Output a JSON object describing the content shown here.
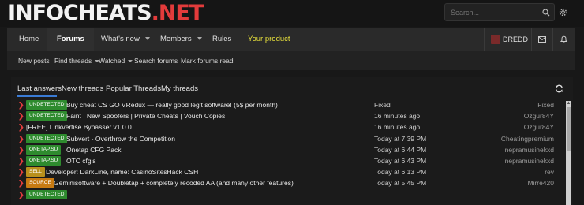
{
  "header": {
    "logo_part1": "INFOCHEATS",
    "logo_part2": ".NET",
    "search_placeholder": "Search...",
    "search_icon": "search-icon",
    "settings_icon": "gear-icon"
  },
  "nav": {
    "items": [
      {
        "label": "Home"
      },
      {
        "label": "Forums"
      },
      {
        "label": "What's new"
      },
      {
        "label": "Members"
      },
      {
        "label": "Rules"
      },
      {
        "label": "Your product"
      }
    ],
    "username": "DREDD",
    "mail_icon": "envelope-icon",
    "alert_icon": "bell-icon"
  },
  "subnav": {
    "items": [
      {
        "label": "New posts"
      },
      {
        "label": "Find threads"
      },
      {
        "label": "Watched"
      },
      {
        "label": "Search forums"
      },
      {
        "label": "Mark forums read"
      }
    ]
  },
  "tabs": [
    {
      "label": "Last answers"
    },
    {
      "label": "New threads"
    },
    {
      "label": "Popular Threads"
    },
    {
      "label": "My threads"
    }
  ],
  "colors": {
    "accent_red": "#e23c3c",
    "tab_underline": "#3a7bd5",
    "your_product": "#e8e13c",
    "badge_undetected": "#2e8b2e",
    "badge_onetap": "#2e8b2e",
    "badge_sell": "#b9901c",
    "badge_source": "#c77a12"
  },
  "threads": [
    {
      "prefix": "UNDETECTED",
      "prefix_color": "#2e8b2e",
      "title": "Buy cheat CS GO VRedux — really good legit software! (5$ per month)",
      "date": "Fixed",
      "user": "Fixed"
    },
    {
      "prefix": "UNDETECTED",
      "prefix_color": "#2e8b2e",
      "title": "Faint | New Spoofers | Private Cheats | Vouch Copies",
      "date": "16 minutes ago",
      "user": "Ozgur84Y"
    },
    {
      "prefix": "",
      "prefix_color": "",
      "title": "[FREE] Linkvertise Bypasser v1.0.0",
      "date": "16 minutes ago",
      "user": "Ozgur84Y"
    },
    {
      "prefix": "UNDETECTED",
      "prefix_color": "#2e8b2e",
      "title": "Subvert - Overthrow the Competition",
      "date": "Today at 7:39 PM",
      "user": "Cheatingpremium"
    },
    {
      "prefix": "ONETAP.SU",
      "prefix_color": "#2e8b2e",
      "title": "Onetap CFG Pack",
      "date": "Today at 6:44 PM",
      "user": "nepramusinekxd"
    },
    {
      "prefix": "ONETAP.SU",
      "prefix_color": "#2e8b2e",
      "title": "OTC cfg's",
      "date": "Today at 6:43 PM",
      "user": "nepramusinekxd"
    },
    {
      "prefix": "SELL",
      "prefix_color": "#b9901c",
      "title": "Developer: DarkLine, name: CasinoSitesHack CSH",
      "date": "Today at 6:13 PM",
      "user": "rev"
    },
    {
      "prefix": "SOURCE",
      "prefix_color": "#c77a12",
      "title": "Geminisoftware + Doubletap + completely recoded AA (and many other features)",
      "date": "Today at 5:45 PM",
      "user": "Mirre420"
    },
    {
      "prefix": "UNDETECTED",
      "prefix_color": "#2e8b2e",
      "title": "",
      "date": "",
      "user": ""
    }
  ]
}
